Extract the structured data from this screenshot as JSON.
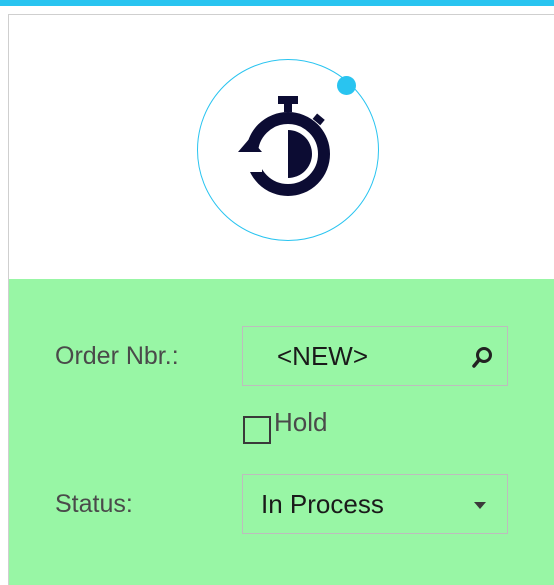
{
  "header": {
    "accent_color": "#29c4f0",
    "icon": "stopwatch-icon"
  },
  "form": {
    "background_color": "#98f6a5",
    "order_nbr": {
      "label": "Order Nbr.:",
      "value": "<NEW>",
      "icon": "search-icon"
    },
    "hold": {
      "label": "Hold",
      "checked": false
    },
    "status": {
      "label": "Status:",
      "value": "In Process",
      "icon": "chevron-down-icon"
    }
  }
}
